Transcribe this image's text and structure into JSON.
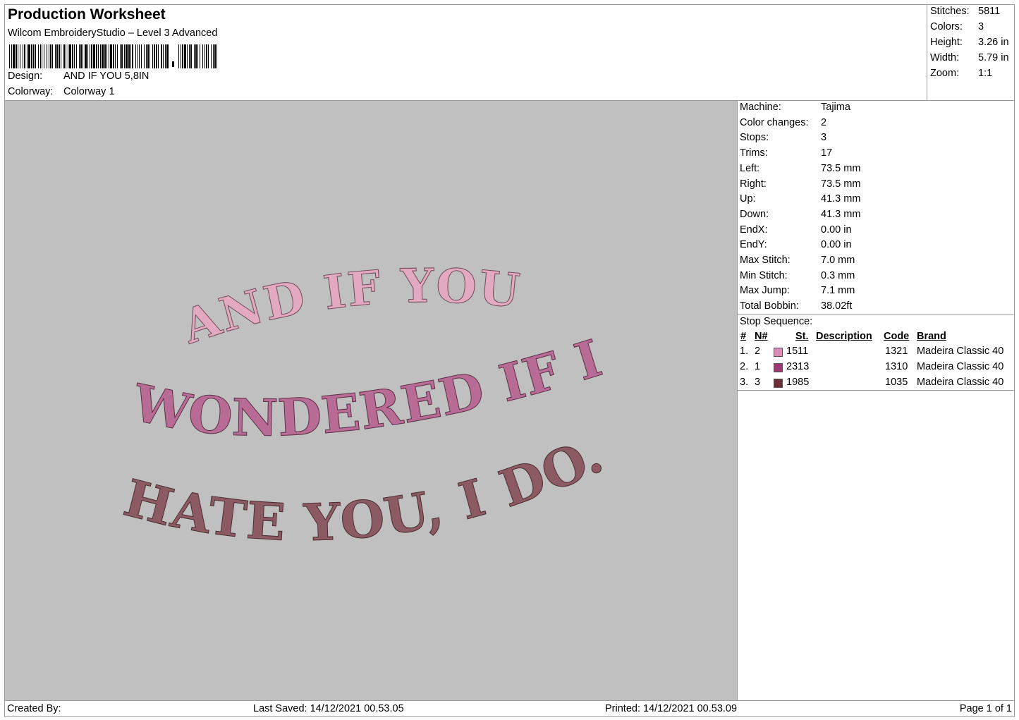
{
  "header": {
    "title": "Production Worksheet",
    "software": "Wilcom EmbroideryStudio – Level 3 Advanced",
    "design_label": "Design:",
    "design_value": "AND IF YOU 5,8IN",
    "colorway_label": "Colorway:",
    "colorway_value": "Colorway 1"
  },
  "summary": [
    {
      "label": "Stitches:",
      "value": "5811"
    },
    {
      "label": "Colors:",
      "value": "3"
    },
    {
      "label": "Height:",
      "value": "3.26 in"
    },
    {
      "label": "Width:",
      "value": "5.79 in"
    },
    {
      "label": "Zoom:",
      "value": "1:1"
    }
  ],
  "machine_info": [
    {
      "label": "Machine:",
      "value": "Tajima"
    },
    {
      "label": "Color changes:",
      "value": "2"
    },
    {
      "label": "Stops:",
      "value": "3"
    },
    {
      "label": "Trims:",
      "value": "17"
    },
    {
      "label": "Left:",
      "value": "73.5 mm"
    },
    {
      "label": "Right:",
      "value": "73.5 mm"
    },
    {
      "label": "Up:",
      "value": "41.3 mm"
    },
    {
      "label": "Down:",
      "value": "41.3 mm"
    },
    {
      "label": "EndX:",
      "value": "0.00 in"
    },
    {
      "label": "EndY:",
      "value": "0.00 in"
    },
    {
      "label": "Max Stitch:",
      "value": "7.0 mm"
    },
    {
      "label": "Min Stitch:",
      "value": "0.3 mm"
    },
    {
      "label": "Max Jump:",
      "value": "7.1 mm"
    },
    {
      "label": "Total Bobbin:",
      "value": "38.02ft"
    }
  ],
  "stop_sequence": {
    "title": "Stop Sequence:",
    "columns": [
      "#",
      "N#",
      "St.",
      "Description",
      "Code",
      "Brand"
    ],
    "rows": [
      {
        "index": "1.",
        "n": "2",
        "color": "#d98cb3",
        "stitches": "1511",
        "description": "",
        "code": "1321",
        "brand": "Madeira Classic 40"
      },
      {
        "index": "2.",
        "n": "1",
        "color": "#9c3a72",
        "stitches": "2313",
        "description": "",
        "code": "1310",
        "brand": "Madeira Classic 40"
      },
      {
        "index": "3.",
        "n": "3",
        "color": "#6b2f3c",
        "stitches": "1985",
        "description": "",
        "code": "1035",
        "brand": "Madeira Classic 40"
      }
    ]
  },
  "design_preview": {
    "background": "#c0c0c0",
    "lines": [
      {
        "text": "AND IF YOU",
        "color": "#e3a9c0"
      },
      {
        "text": "WONDERED IF I",
        "color": "#b86b94"
      },
      {
        "text": "HATE YOU, I DO.",
        "color": "#8c5a62"
      }
    ]
  },
  "footer": {
    "created_by": "Created By:",
    "last_saved": "Last Saved: 14/12/2021 00.53.05",
    "printed": "Printed: 14/12/2021 00.53.09",
    "page": "Page 1 of 1"
  }
}
